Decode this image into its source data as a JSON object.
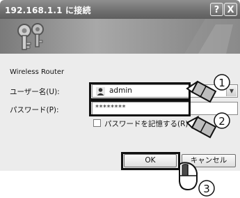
{
  "window": {
    "title": "192.168.1.1 に接続",
    "help_button": "?",
    "close_button": "X"
  },
  "dialog": {
    "device_label": "Wireless Router",
    "username_label": "ユーザー名(U):",
    "username_value": "admin",
    "password_label": "パスワード(P):",
    "password_value": "********",
    "remember_label": "パスワードを記憶する(R)",
    "remember_checked": false,
    "ok_label": "OK",
    "cancel_label": "キャンセル"
  },
  "annotations": {
    "step1": "①",
    "step2": "②",
    "step3": "③"
  },
  "icons": {
    "banner": "keys-icon",
    "user": "user-icon",
    "pen1": "pencil-icon",
    "pen2": "pencil-icon",
    "mouse": "mouse-icon"
  }
}
